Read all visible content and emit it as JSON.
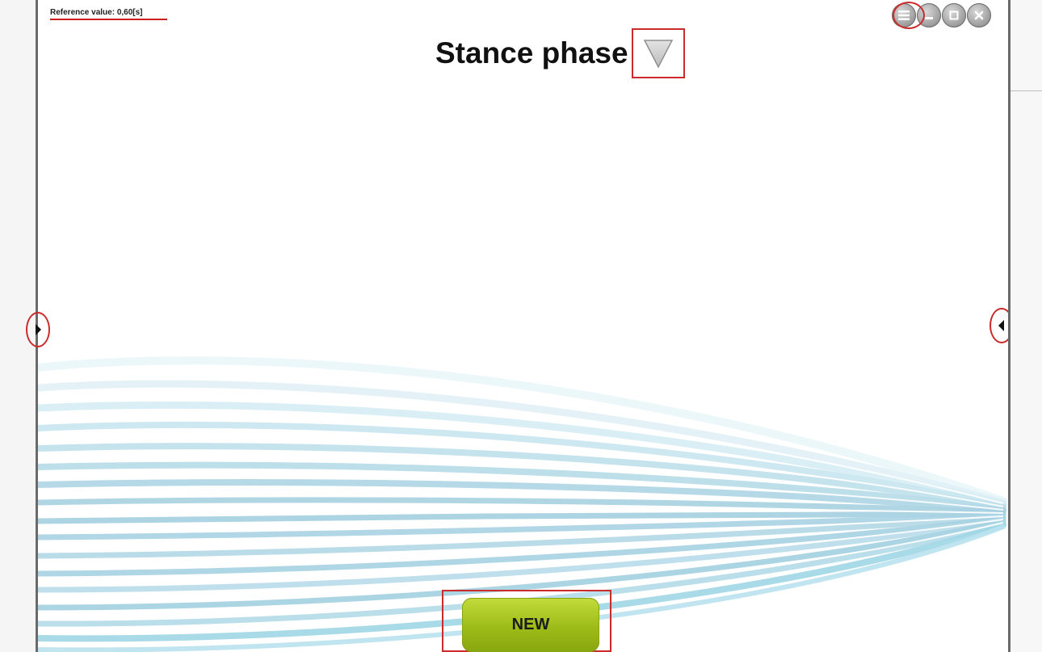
{
  "reference": {
    "text": "Reference value: 0,60[s]"
  },
  "header": {
    "title": "Stance phase"
  },
  "window_controls": [
    {
      "name": "menu",
      "icon": "hamburger-menu-icon"
    },
    {
      "name": "minimize",
      "icon": "minimize-icon"
    },
    {
      "name": "maximize",
      "icon": "maximize-icon"
    },
    {
      "name": "close",
      "icon": "close-icon"
    }
  ],
  "dropdown": {
    "icon": "triangle-down-icon"
  },
  "left_toggle": {
    "icon": "arrow-right-icon"
  },
  "right_toggle": {
    "icon": "arrow-left-icon"
  },
  "actions": {
    "new_label": "NEW"
  },
  "colors": {
    "accent_red": "#cc2b2b",
    "button_green": "#9dbb18",
    "wave_blue": "#9fd6e6"
  }
}
